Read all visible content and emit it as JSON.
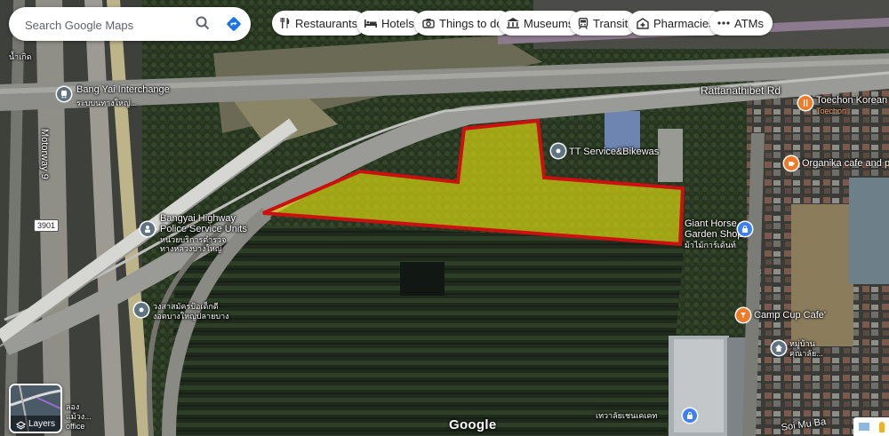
{
  "search": {
    "placeholder": "Search Google Maps"
  },
  "icons": {
    "search": "search-icon",
    "directions": "directions-icon"
  },
  "categories": [
    {
      "label": "Restaurants",
      "icon": "fork-knife-icon"
    },
    {
      "label": "Hotels",
      "icon": "bed-icon"
    },
    {
      "label": "Things to do",
      "icon": "camera-icon"
    },
    {
      "label": "Museums",
      "icon": "museum-icon"
    },
    {
      "label": "Transit",
      "icon": "train-icon"
    },
    {
      "label": "Pharmacies",
      "icon": "pharmacy-icon"
    },
    {
      "label": "ATMs",
      "icon": "atm-icon"
    }
  ],
  "map_labels": {
    "bang_yai_interchange": "Bang Yai Interchange",
    "bang_yai_interchange_th": "ระบบนทางใหญ่...",
    "motorway": "Motorway 9",
    "road_number": "3901",
    "rattanathibet_rd": "Rattanathibet Rd",
    "police_line1": "Bangyai Highway",
    "police_line2": "Police Service Units",
    "police_th1": "หน่วยบริการตำรวจ",
    "police_th2": "ทางหลวงบางใหญ่",
    "tt_service": "TT Service&Bikewas",
    "toechon_line1": "Toechon Korean E",
    "toechon_line2": "Toechon",
    "organika": "Organika cafe and pl",
    "giant_horse_line1": "Giant Horse",
    "giant_horse_line2": "Garden Shops",
    "giant_horse_th": "ม้าไม้การ์เด้นท์",
    "camp_cup": "Camp Cup Cafe'",
    "village_th1": "หมู่บ้าน",
    "village_th2": "คุณาลัย...",
    "college_th": "เทวาลัยเชนเคเคท",
    "left_th1": "วงสาสมัครป้อเด็กดี",
    "left_th2": "งอตบางใหญ่ปลายบาง",
    "edge_th_top": "น้ำเกิด",
    "edge_th_bottom1": "ลอง",
    "edge_th_bottom2": "แม้วง...",
    "edge_th_bottom3": "office",
    "soi": "Soi Mu Ba"
  },
  "layers": {
    "label": "Layers",
    "icon": "layers-icon"
  },
  "branding": {
    "logo": "Google"
  },
  "colors": {
    "highlight_fill": "#d8d80f",
    "highlight_stroke": "#cc1010",
    "pin_blue": "#3e80f2",
    "pin_gray": "#5f7380",
    "pin_orange": "#ef7a28"
  }
}
